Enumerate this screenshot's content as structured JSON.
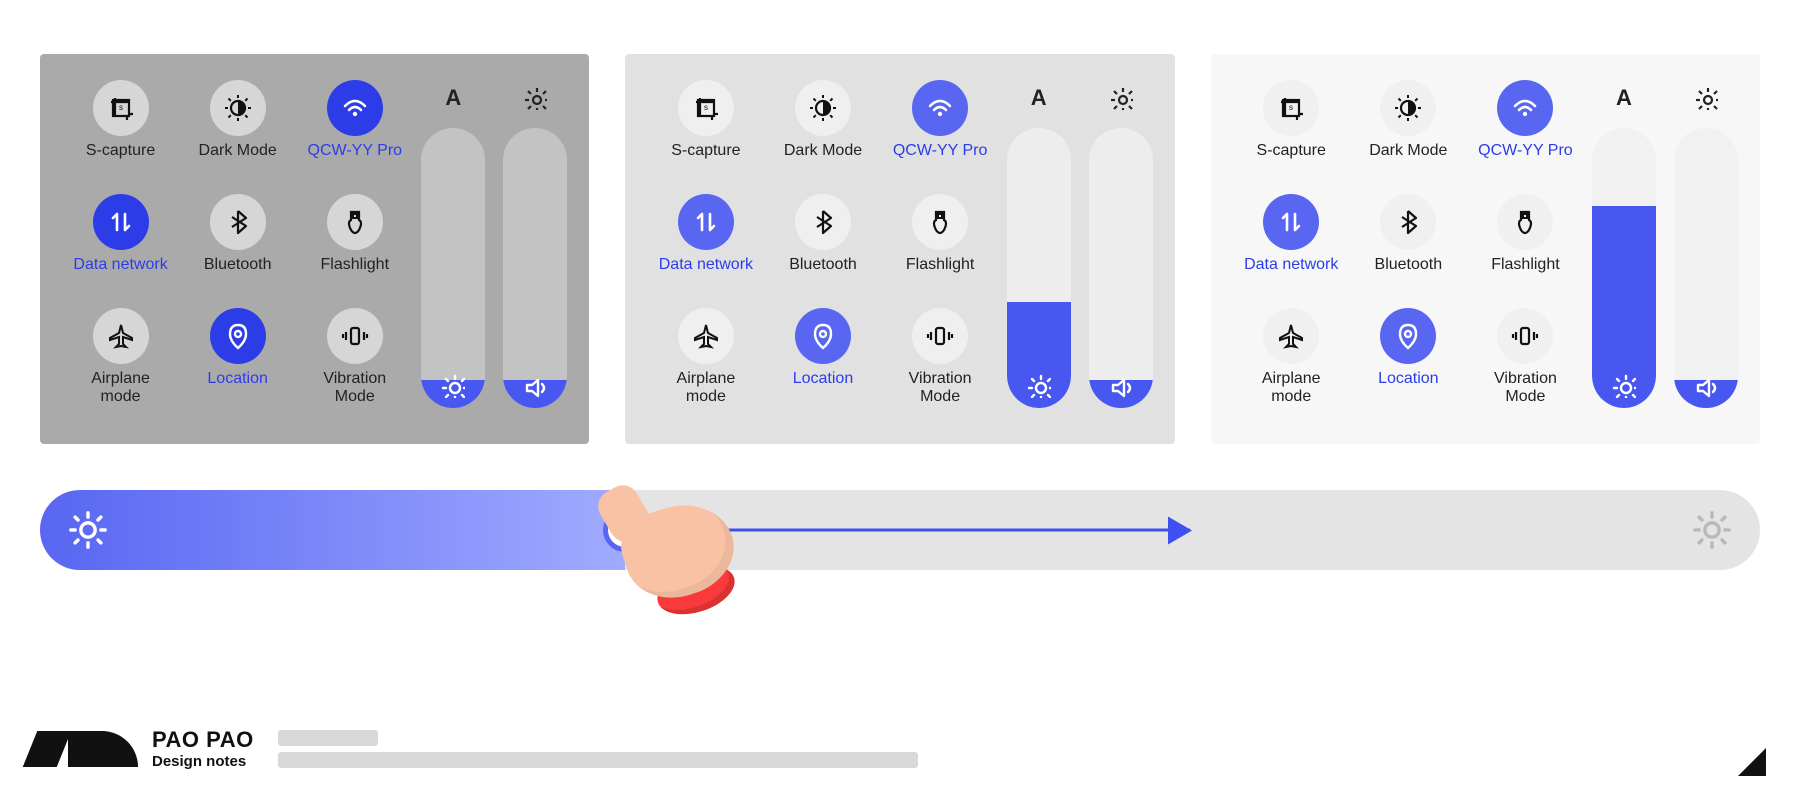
{
  "colors": {
    "accent": "#2c3de8",
    "accent_light": "#5866f2"
  },
  "top_icons": {
    "text_A": "A"
  },
  "tiles": {
    "s_capture": "S-capture",
    "dark_mode": "Dark Mode",
    "wifi": "QCW-YY Pro",
    "data": "Data network",
    "bluetooth": "Bluetooth",
    "flashlight": "Flashlight",
    "airplane": "Airplane\nmode",
    "location": "Location",
    "vibration": "Vibration\nMode"
  },
  "panels": [
    {
      "variant": "dark",
      "brightness_pct": 10,
      "volume_pct": 10
    },
    {
      "variant": "mid",
      "brightness_pct": 38,
      "volume_pct": 10
    },
    {
      "variant": "light",
      "brightness_pct": 72,
      "volume_pct": 10
    }
  ],
  "mega_slider": {
    "value_pct": 34
  },
  "brand": {
    "title": "PAO PAO",
    "subtitle": "Design notes"
  }
}
